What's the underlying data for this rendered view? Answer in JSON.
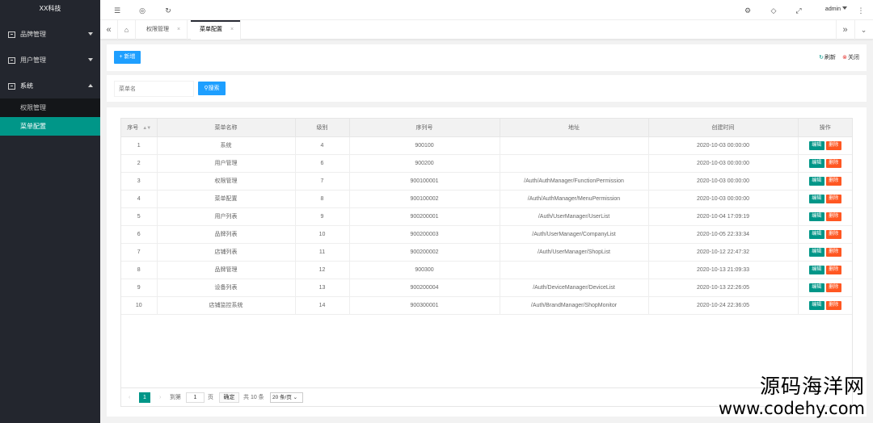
{
  "app": {
    "logo": "XX科技"
  },
  "sidebar": {
    "items": [
      {
        "label": "品牌管理",
        "icon": "doc-icon",
        "expanded": false
      },
      {
        "label": "用户管理",
        "icon": "doc-icon",
        "expanded": false
      },
      {
        "label": "系统",
        "icon": "doc-icon",
        "expanded": true
      }
    ],
    "sub_items": [
      {
        "label": "权限管理",
        "active": false
      },
      {
        "label": "菜单配置",
        "active": true
      }
    ]
  },
  "header": {
    "icons": [
      "menu-fold-icon",
      "target-icon",
      "refresh-icon",
      "theme-icon",
      "tag-icon",
      "fullscreen-icon",
      "more-vertical-icon"
    ],
    "user": "admin"
  },
  "tabs": {
    "items": [
      {
        "label": "权限管理",
        "active": false
      },
      {
        "label": "菜单配置",
        "active": true
      }
    ],
    "close_glyph": "×"
  },
  "toolbar": {
    "add_label": "+ 新增",
    "refresh_label": "刷新",
    "close_label": "关闭"
  },
  "search": {
    "placeholder": "菜单名",
    "button_label": "搜索"
  },
  "table": {
    "columns": [
      "序号",
      "菜单名称",
      "级别",
      "序列号",
      "地址",
      "创建时间",
      "操作"
    ],
    "edit_label": "编辑",
    "delete_label": "删除",
    "rows": [
      [
        "1",
        "系统",
        "4",
        "900100",
        "",
        "2020-10-03 00:00:00"
      ],
      [
        "2",
        "用户管理",
        "6",
        "900200",
        "",
        "2020-10-03 00:00:00"
      ],
      [
        "3",
        "权限管理",
        "7",
        "900100001",
        "/Auth/AuthManager/FunctionPermission",
        "2020-10-03 00:00:00"
      ],
      [
        "4",
        "菜单配置",
        "8",
        "900100002",
        "/Auth/AuthManager/MenuPermission",
        "2020-10-03 00:00:00"
      ],
      [
        "5",
        "用户列表",
        "9",
        "900200001",
        "/Auth/UserManager/UserList",
        "2020-10-04 17:09:19"
      ],
      [
        "6",
        "品牌列表",
        "10",
        "900200003",
        "/Auth/UserManager/CompanyList",
        "2020-10-05 22:33:34"
      ],
      [
        "7",
        "店铺列表",
        "11",
        "900200002",
        "/Auth/UserManager/ShopList",
        "2020-10-12 22:47:32"
      ],
      [
        "8",
        "品牌管理",
        "12",
        "900300",
        "",
        "2020-10-13 21:09:33"
      ],
      [
        "9",
        "设备列表",
        "13",
        "900200004",
        "/Auth/DeviceManager/DeviceList",
        "2020-10-13 22:26:05"
      ],
      [
        "10",
        "店铺监控系统",
        "14",
        "900300001",
        "/Auth/BrandManager/ShopMonitor",
        "2020-10-24 22:36:05"
      ]
    ]
  },
  "pager": {
    "prev": "‹",
    "current": "1",
    "next": "›",
    "goto_label": "到第",
    "goto_value": "1",
    "page_unit": "页",
    "confirm_label": "确定",
    "total_label": "共 10 条",
    "size_label": "20 条/页"
  },
  "watermark": {
    "cn": "源码海洋网",
    "url": "www.codehy.com"
  }
}
